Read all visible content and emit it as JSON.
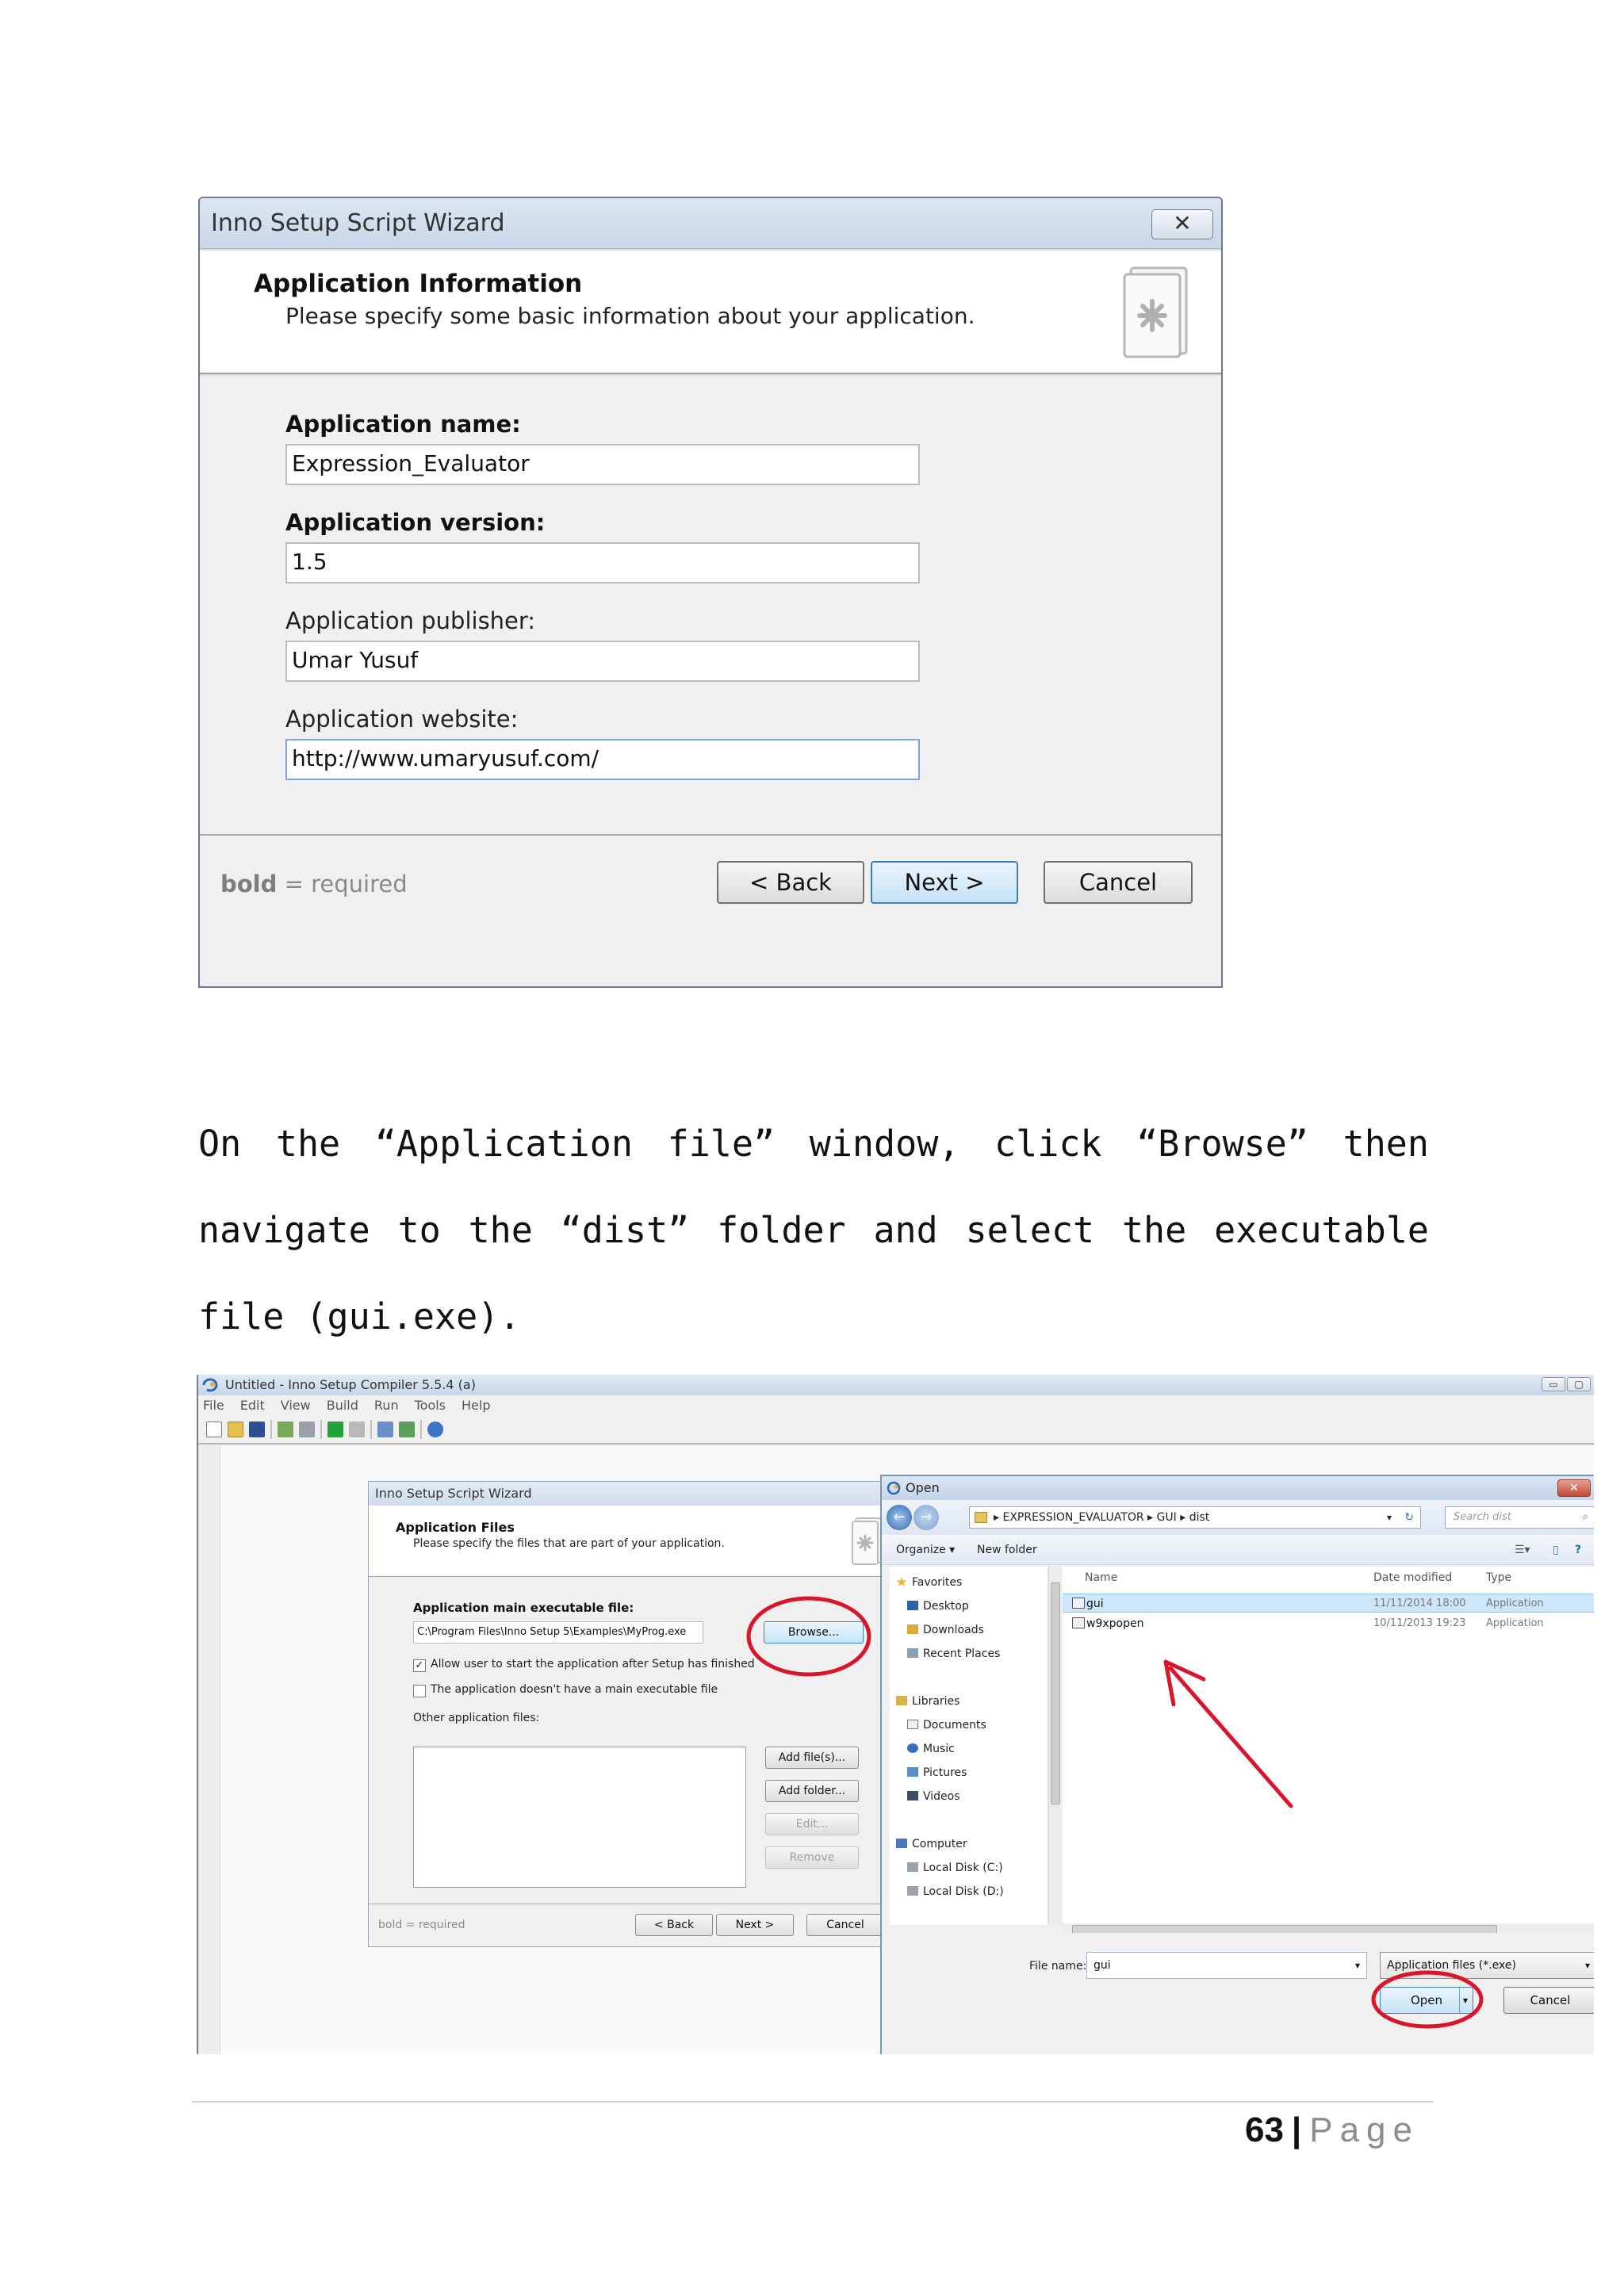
{
  "wizard1": {
    "title": "Inno Setup Script Wizard",
    "close_glyph": "✕",
    "header_title": "Application Information",
    "header_subtitle": "Please specify some basic information about your application.",
    "fields": [
      {
        "label": "Application name:",
        "value": "Expression_Evaluator",
        "required": true
      },
      {
        "label": "Application version:",
        "value": "1.5",
        "required": true
      },
      {
        "label": "Application publisher:",
        "value": "Umar Yusuf",
        "required": false
      },
      {
        "label": "Application website:",
        "value": "http://www.umaryusuf.com/",
        "required": false
      }
    ],
    "required_note_bold": "bold",
    "required_note_rest": " = required",
    "buttons": {
      "back": "< Back",
      "next": "Next >",
      "cancel": "Cancel"
    }
  },
  "paragraph": "On the “Application file” window, click “Browse” then navigate to the “dist” folder and select the executable file (gui.exe).",
  "screenshot2": {
    "ide_title": "Untitled - Inno Setup Compiler 5.5.4 (a)",
    "menu": [
      "File",
      "Edit",
      "View",
      "Build",
      "Run",
      "Tools",
      "Help"
    ],
    "wizard": {
      "title": "Inno Setup Script Wizard",
      "header_title": "Application Files",
      "header_subtitle": "Please specify the files that are part of your application.",
      "main_exe_label": "Application main executable file:",
      "main_exe_value": "C:\\Program Files\\Inno Setup 5\\Examples\\MyProg.exe",
      "browse": "Browse...",
      "check_allow": "Allow user to start the application after Setup has finished",
      "check_allow_mark": "✓",
      "check_noexe": "The application doesn't have a main executable file",
      "other_files_label": "Other application files:",
      "add_files": "Add file(s)...",
      "add_folder": "Add folder...",
      "edit": "Edit...",
      "remove": "Remove",
      "required_note": "bold = required",
      "back": "< Back",
      "next": "Next >",
      "cancel": "Cancel"
    },
    "open_dialog": {
      "title": "Open",
      "path": [
        "EXPRESSION_EVALUATOR",
        "GUI",
        "dist"
      ],
      "path_sep": "▸",
      "search_placeholder": "Search dist",
      "organize": "Organize ▾",
      "new_folder": "New folder",
      "nav": {
        "favorites": "Favorites",
        "favorites_items": [
          "Desktop",
          "Downloads",
          "Recent Places"
        ],
        "libraries": "Libraries",
        "libraries_items": [
          "Documents",
          "Music",
          "Pictures",
          "Videos"
        ],
        "computer": "Computer",
        "computer_items": [
          "Local Disk (C:)",
          "Local Disk (D:)"
        ]
      },
      "columns": {
        "name": "Name",
        "date": "Date modified",
        "type": "Type"
      },
      "files": [
        {
          "name": "gui",
          "date": "11/11/2014 18:00",
          "type": "Application",
          "selected": true
        },
        {
          "name": "w9xpopen",
          "date": "10/11/2013 19:23",
          "type": "Application",
          "selected": false
        }
      ],
      "file_name_label": "File name:",
      "file_name_value": "gui",
      "file_type": "Application files (*.exe)",
      "open": "Open",
      "cancel": "Cancel"
    }
  },
  "footer": {
    "page_number": "63",
    "separator": "|",
    "word": "Page"
  },
  "colors": {
    "annotation": "#d9142b",
    "accent": "#3c7fb1"
  }
}
